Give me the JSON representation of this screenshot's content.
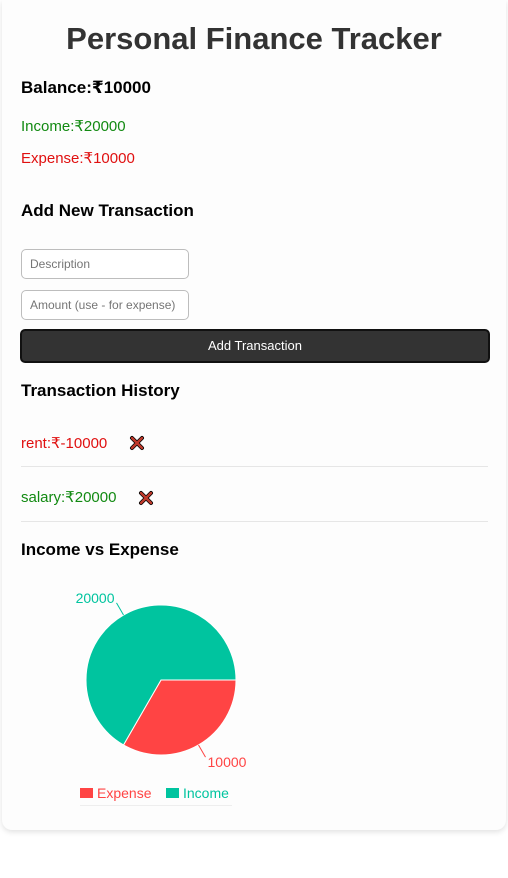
{
  "app": {
    "title": "Personal Finance Tracker"
  },
  "summary": {
    "balance": "Balance:₹10000",
    "income": "Income:₹20000",
    "expense": "Expense:₹10000"
  },
  "form": {
    "heading": "Add New Transaction",
    "description_placeholder": "Description",
    "amount_placeholder": "Amount (use - for expense)",
    "submit_label": "Add Transaction"
  },
  "history": {
    "heading": "Transaction History",
    "items": [
      {
        "text": "rent:₹-10000",
        "type": "expense",
        "delete_icon": "close-icon"
      },
      {
        "text": "salary:₹20000",
        "type": "income",
        "delete_icon": "close-icon"
      }
    ]
  },
  "chart_section": {
    "heading": "Income vs Expense"
  },
  "colors": {
    "income": "#00c49f",
    "expense": "#ff4444",
    "income_text": "#128a12",
    "expense_text": "#e01010"
  },
  "chart_data": {
    "type": "pie",
    "categories": [
      "Expense",
      "Income"
    ],
    "values": [
      10000,
      20000
    ],
    "data_labels": [
      "10000",
      "20000"
    ],
    "colors": [
      "#ff4444",
      "#00c49f"
    ],
    "legend": [
      "Expense",
      "Income"
    ],
    "legend_position": "bottom",
    "title": ""
  }
}
